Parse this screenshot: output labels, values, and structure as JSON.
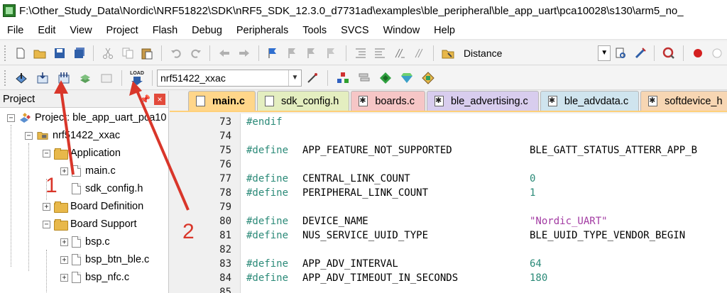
{
  "window": {
    "title": "F:\\Other_Study_Data\\Nordic\\NRF51822\\SDK\\nRF5_SDK_12.3.0_d7731ad\\examples\\ble_peripheral\\ble_app_uart\\pca10028\\s130\\arm5_no_"
  },
  "menu": [
    "File",
    "Edit",
    "View",
    "Project",
    "Flash",
    "Debug",
    "Peripherals",
    "Tools",
    "SVCS",
    "Window",
    "Help"
  ],
  "toolbar1": {
    "find_text": "Distance"
  },
  "toolbar2": {
    "load_label": "LOAD",
    "target": "nrf51422_xxac"
  },
  "project_panel": {
    "title": "Project",
    "pin_glyph": "📌",
    "close_glyph": "×",
    "tree": [
      {
        "label": "Project: ble_app_uart_pca10",
        "level": 0,
        "kind": "project",
        "expander": "−"
      },
      {
        "label": "nrf51422_xxac",
        "level": 1,
        "kind": "target",
        "expander": "−"
      },
      {
        "label": "Application",
        "level": 2,
        "kind": "folder",
        "expander": "−"
      },
      {
        "label": "main.c",
        "level": 3,
        "kind": "file",
        "expander": "+"
      },
      {
        "label": "sdk_config.h",
        "level": 3,
        "kind": "file",
        "expander": ""
      },
      {
        "label": "Board Definition",
        "level": 2,
        "kind": "folder",
        "expander": "+"
      },
      {
        "label": "Board Support",
        "level": 2,
        "kind": "folder",
        "expander": "−"
      },
      {
        "label": "bsp.c",
        "level": 3,
        "kind": "file",
        "expander": "+"
      },
      {
        "label": "bsp_btn_ble.c",
        "level": 3,
        "kind": "file",
        "expander": "+"
      },
      {
        "label": "bsp_nfc.c",
        "level": 3,
        "kind": "file",
        "expander": "+"
      }
    ]
  },
  "tabs": [
    {
      "label": "main.c",
      "active": true
    },
    {
      "label": "sdk_config.h",
      "active": false
    },
    {
      "label": "boards.c",
      "active": false
    },
    {
      "label": "ble_advertising.c",
      "active": false
    },
    {
      "label": "ble_advdata.c",
      "active": false
    },
    {
      "label": "softdevice_h",
      "active": false
    }
  ],
  "code": [
    {
      "line": "73",
      "directive": "#endif",
      "name": "",
      "value": "",
      "vtype": ""
    },
    {
      "line": "74",
      "directive": "",
      "name": "",
      "value": "",
      "vtype": ""
    },
    {
      "line": "75",
      "directive": "#define",
      "name": "APP_FEATURE_NOT_SUPPORTED",
      "value": "BLE_GATT_STATUS_ATTERR_APP_B",
      "vtype": "ident"
    },
    {
      "line": "76",
      "directive": "",
      "name": "",
      "value": "",
      "vtype": ""
    },
    {
      "line": "77",
      "directive": "#define",
      "name": "CENTRAL_LINK_COUNT",
      "value": "0",
      "vtype": "num"
    },
    {
      "line": "78",
      "directive": "#define",
      "name": "PERIPHERAL_LINK_COUNT",
      "value": "1",
      "vtype": "num"
    },
    {
      "line": "79",
      "directive": "",
      "name": "",
      "value": "",
      "vtype": ""
    },
    {
      "line": "80",
      "directive": "#define",
      "name": "DEVICE_NAME",
      "value": "\"Nordic_UART\"",
      "vtype": "str"
    },
    {
      "line": "81",
      "directive": "#define",
      "name": "NUS_SERVICE_UUID_TYPE",
      "value": "BLE_UUID_TYPE_VENDOR_BEGIN",
      "vtype": "ident"
    },
    {
      "line": "82",
      "directive": "",
      "name": "",
      "value": "",
      "vtype": ""
    },
    {
      "line": "83",
      "directive": "#define",
      "name": "APP_ADV_INTERVAL",
      "value": "64",
      "vtype": "num"
    },
    {
      "line": "84",
      "directive": "#define",
      "name": "APP_ADV_TIMEOUT_IN_SECONDS",
      "value": "180",
      "vtype": "num"
    },
    {
      "line": "85",
      "directive": "",
      "name": "",
      "value": "",
      "vtype": ""
    }
  ],
  "annotations": [
    {
      "label": "1"
    },
    {
      "label": "2"
    }
  ],
  "colors": {
    "annotation_red": "#d9362a",
    "directive_teal": "#2b8a78",
    "string_purple": "#a23aa2",
    "active_tab": "#ffd68a"
  }
}
